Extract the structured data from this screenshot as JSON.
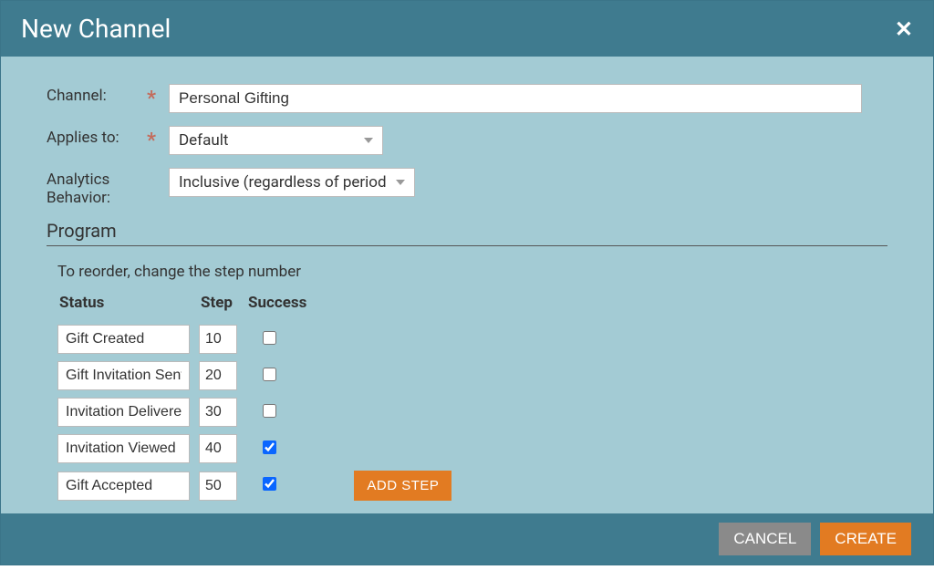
{
  "header": {
    "title": "New Channel"
  },
  "form": {
    "channel_label": "Channel:",
    "channel_value": "Personal Gifting",
    "applies_label": "Applies to:",
    "applies_value": "Default",
    "analytics_label": "Analytics Behavior:",
    "analytics_value": "Inclusive (regardless of period co"
  },
  "program": {
    "section_title": "Program",
    "hint": "To reorder, change the step number",
    "columns": {
      "status": "Status",
      "step": "Step",
      "success": "Success"
    },
    "rows": [
      {
        "status": "Gift Created",
        "step": "10",
        "success": false
      },
      {
        "status": "Gift Invitation Sent",
        "step": "20",
        "success": false
      },
      {
        "status": "Invitation Delivered",
        "step": "30",
        "success": false
      },
      {
        "status": "Invitation Viewed",
        "step": "40",
        "success": true
      },
      {
        "status": "Gift Accepted",
        "step": "50",
        "success": true
      }
    ],
    "add_step_label": "ADD STEP"
  },
  "footer": {
    "cancel": "CANCEL",
    "create": "CREATE"
  }
}
